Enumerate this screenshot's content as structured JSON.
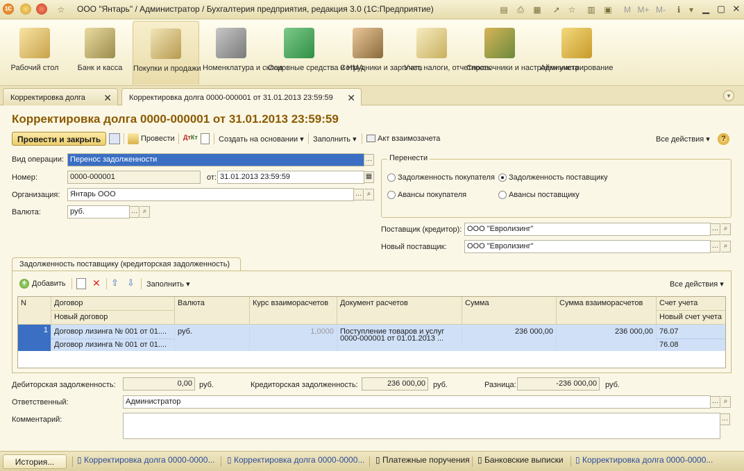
{
  "window": {
    "title": "ООО \"Янтарь\" / Администратор / Бухгалтерия предприятия, редакция 3.0  (1С:Предприятие)",
    "logo": "1С",
    "toolbar_mem": [
      "M",
      "M+",
      "M-"
    ]
  },
  "sections": [
    {
      "label": "Рабочий стол",
      "icon": "desktop-icon"
    },
    {
      "label": "Банк и касса",
      "icon": "bank-icon"
    },
    {
      "label": "Покупки и продажи",
      "icon": "truck-icon"
    },
    {
      "label": "Номенклатура и склад",
      "icon": "warehouse-icon"
    },
    {
      "label": "Основные средства и НМА",
      "icon": "assets-icon"
    },
    {
      "label": "Сотрудники и зарплата",
      "icon": "employee-icon"
    },
    {
      "label": "Учет, налоги, отчетность",
      "icon": "reports-icon"
    },
    {
      "label": "Справочники и настройки учета",
      "icon": "binders-icon"
    },
    {
      "label": "Администрирование",
      "icon": "admin-icon"
    }
  ],
  "tabs": [
    {
      "label": "Корректировка долга"
    },
    {
      "label": "Корректировка долга 0000-000001 от 31.01.2013 23:59:59"
    }
  ],
  "form": {
    "title": "Корректировка долга 0000-000001 от 31.01.2013 23:59:59",
    "toolbar": {
      "post_close": "Провести и закрыть",
      "post": "Провести",
      "create_based": "Создать на основании",
      "fill": "Заполнить",
      "act": "Акт взаимозачета",
      "all_actions": "Все действия",
      "help": "?"
    },
    "op_type_label": "Вид операции:",
    "op_type_value": "Перенос задолженности",
    "number_label": "Номер:",
    "number_value": "0000-000001",
    "date_label": "от:",
    "date_value": "31.01.2013 23:59:59",
    "org_label": "Организация:",
    "org_value": "Янтарь ООО",
    "currency_label": "Валюта:",
    "currency_value": "руб.",
    "transfer_group": {
      "title": "Перенести",
      "options": [
        {
          "label": "Задолженность покупателя",
          "selected": false
        },
        {
          "label": "Задолженность поставщику",
          "selected": true
        },
        {
          "label": "Авансы покупателя",
          "selected": false
        },
        {
          "label": "Авансы поставщику",
          "selected": false
        }
      ]
    },
    "supplier_label": "Поставщик (кредитор):",
    "supplier_value": "ООО \"Евролизинг\"",
    "new_supplier_label": "Новый поставщик:",
    "new_supplier_value": "ООО \"Евролизинг\"",
    "table_tab": "Задолженность поставщику (кредиторская задолженность)",
    "table_toolbar": {
      "add": "Добавить",
      "fill": "Заполнить",
      "all_actions": "Все действия"
    },
    "table": {
      "headers": [
        "N",
        "Договор",
        "Валюта",
        "Курс взаиморасчетов",
        "Документ расчетов",
        "Сумма",
        "Сумма взаиморасчетов",
        "Счет учета"
      ],
      "subheaders": {
        "contract": "Новый договор",
        "account": "Новый счет учета"
      },
      "rows": [
        {
          "n": "1",
          "contract": "Договор лизинга № 001 от 01....",
          "new_contract": "Договор лизинга № 001 от 01....",
          "currency": "руб.",
          "rate": "1,0000",
          "doc_line1": "Поступление товаров и услуг",
          "doc_line2": "0000-000001 от 01.01.2013 ...",
          "sum": "236 000,00",
          "settle_sum": "236 000,00",
          "account": "76.07",
          "new_account": "76.08"
        }
      ]
    },
    "debit_label": "Дебиторская задолженность:",
    "debit_value": "0,00",
    "credit_label": "Кредиторская задолженность:",
    "credit_value": "236 000,00",
    "diff_label": "Разница:",
    "diff_value": "-236 000,00",
    "rub": "руб.",
    "responsible_label": "Ответственный:",
    "responsible_value": "Администратор",
    "comment_label": "Комментарий:",
    "comment_value": ""
  },
  "taskbar": {
    "history": "История...",
    "items": [
      "Корректировка долга 0000-0000...",
      "Корректировка долга 0000-0000...",
      "Платежные поручения",
      "Банковские выписки",
      "Корректировка долга 0000-0000..."
    ]
  },
  "colors": {
    "accent_title": "#8a5a00",
    "selection": "#3a6fc4",
    "row_highlight": "#cfe0f7",
    "link": "#2b4a9c"
  }
}
